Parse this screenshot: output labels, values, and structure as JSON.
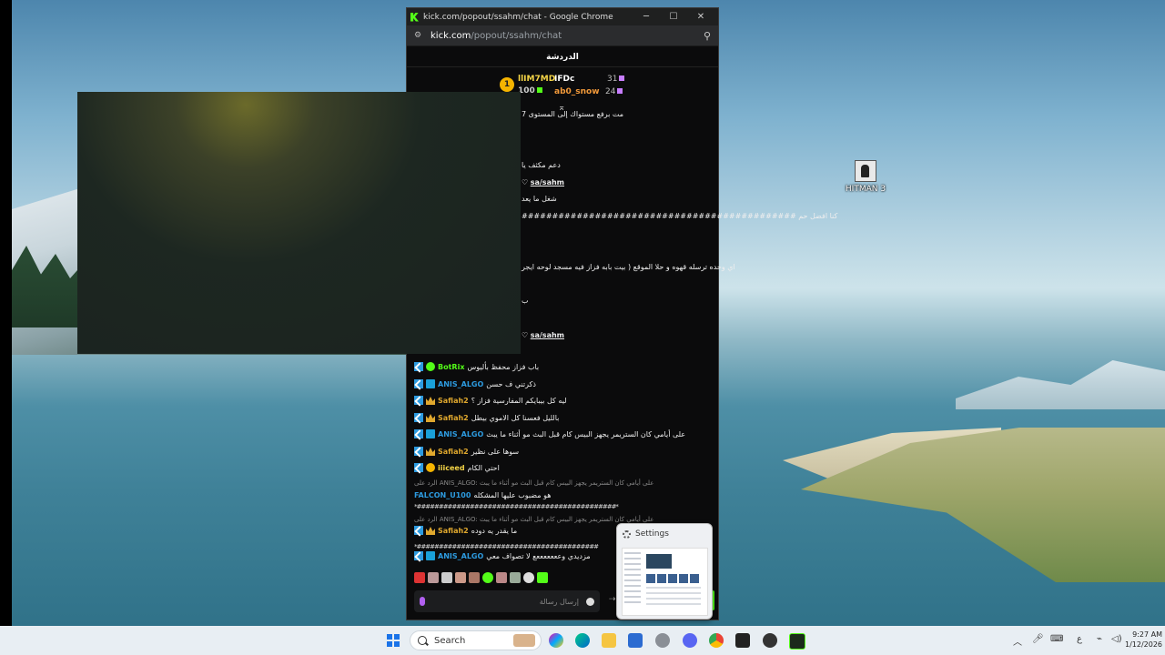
{
  "window": {
    "title": "kick.com/popout/ssahm/chat - Google Chrome",
    "url_host": "kick.com",
    "url_path": "/popout/ssahm/chat",
    "minimize": "─",
    "maximize": "☐",
    "close": "✕"
  },
  "chat": {
    "title": "الدردشة",
    "leaderboard": {
      "rank": "1",
      "first_name": "llIM7MD",
      "first_count": "100",
      "second_name": "IFDc",
      "second_count": "31",
      "third_name": "ab0_snow",
      "third_count": "24"
    },
    "partial_messages": [
      "مت برفع مستواك إلى المستوى 7",
      "دعم مكثف يا",
      "sa/sahm",
      "شغل ما يعد",
      "كنا افضل حم",
      "#############################################",
      "اي وحده ترسله قهوه و حلا الموقع ( بيت بابه فزاز فيه مسجد لوحه ايجر",
      "ب",
      "sa/sahm"
    ],
    "messages": [
      {
        "user": "BotRix",
        "color": "#53fc18",
        "badge": "bot",
        "text": "باب فزاز محفظ بأليوس"
      },
      {
        "user": "ANIS_ALGO",
        "color": "#2d9be0",
        "badge": "2",
        "text": "ذكرتني ف حسن"
      },
      {
        "user": "Safiah2",
        "color": "#e0a82e",
        "badge": "crown",
        "text": "ليه كل بيبايكم المفارسية فزاز ؟"
      },
      {
        "user": "Safiah2",
        "color": "#e0a82e",
        "badge": "crown",
        "text": "بالليل فعسنا كل الاموي بيطل"
      },
      {
        "user": "ANIS_ALGO",
        "color": "#2d9be0",
        "badge": "2",
        "text": "على أيامي كان الستريمر يجهز البيس كام قبل البث مو أثناء ما يبث"
      },
      {
        "user": "Safiah2",
        "color": "#e0a82e",
        "badge": "crown",
        "text": "سوها على نظير"
      },
      {
        "user": "iiiceed",
        "color": "#f5d547",
        "badge": "medal",
        "text": "احتي الكام"
      }
    ],
    "reply1": "الرد على ANIS_ALGO: على أيامي كان الستريمر يجهز البيس كام قبل البث مو أثناء ما يبث",
    "falcon_user": "FALCON_U100",
    "falcon_text": "هو مضبوب عليها المشكله",
    "hash_line": "*#############################################*",
    "reply2": "الرد على ANIS_ALGO: على أيامي كان الستريمر يجهز البيس كام قبل البث مو أثناء ما يبث",
    "safiah_reply_text": "ما يقدر يه دوده",
    "hash_line2": "*#########################################",
    "last_user": "ANIS_ALGO",
    "last_text": "مزديدي وعععععععع لا تصواف معي",
    "input_placeholder": "إرسال رسالة",
    "send": "⇢"
  },
  "settings_popup": {
    "title": "Settings"
  },
  "desktop": {
    "icon_label": "HITMAN 3"
  },
  "taskbar": {
    "search_placeholder": "Search",
    "time": "9:27 AM",
    "date": "1/12/2026",
    "lang": "ع"
  },
  "colors": {
    "kick_green": "#53fc18",
    "chrome_dark": "#0b0b0c"
  }
}
